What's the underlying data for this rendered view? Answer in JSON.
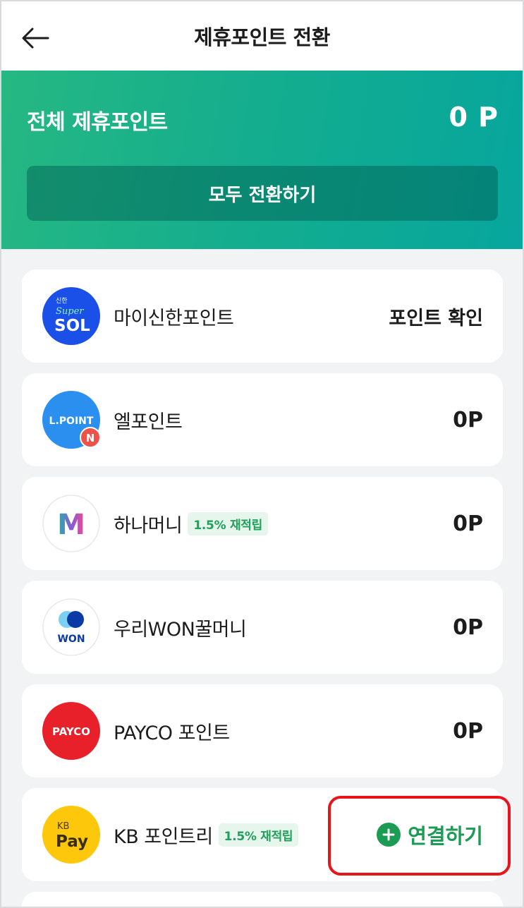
{
  "header": {
    "title": "제휴포인트 전환",
    "back_icon": "arrow-left-icon"
  },
  "summary": {
    "label": "전체 제휴포인트",
    "total": "0 P",
    "convert_all_label": "모두 전환하기"
  },
  "partners": [
    {
      "name": "마이신한포인트",
      "value": "포인트 확인",
      "logo": {
        "icon": "shinhan-super-sol-icon",
        "small": "신한",
        "script": "Super",
        "main": "SOL",
        "color": "#1a4fe8"
      }
    },
    {
      "name": "엘포인트",
      "value": "0P",
      "logo": {
        "icon": "lpoint-icon",
        "main": "L.POINT",
        "badge": "N",
        "color": "#2b8ff0",
        "badge_color": "#f0504a"
      }
    },
    {
      "name": "하나머니",
      "badge": "1.5% 재적립",
      "value": "0P",
      "logo": {
        "icon": "hana-money-icon",
        "main": "M"
      }
    },
    {
      "name": "우리WON꿀머니",
      "value": "0P",
      "logo": {
        "icon": "woori-won-icon",
        "main": "WON",
        "color": "#0b3aa6"
      }
    },
    {
      "name": "PAYCO 포인트",
      "value": "0P",
      "logo": {
        "icon": "payco-icon",
        "main": "PAYCO",
        "color": "#e8202a"
      }
    },
    {
      "name": "KB 포인트리",
      "badge": "1.5% 재적립",
      "value": "연결하기",
      "action_icon": "plus-circle-icon",
      "logo": {
        "icon": "kb-pay-icon",
        "small": "KB",
        "main": "Pay",
        "color": "#fdc70c"
      }
    }
  ],
  "colors": {
    "accent_green": "#1c9b55",
    "hero_gradient_start": "#26b882",
    "hero_gradient_end": "#07a69e",
    "highlight_red": "#e8141c"
  }
}
